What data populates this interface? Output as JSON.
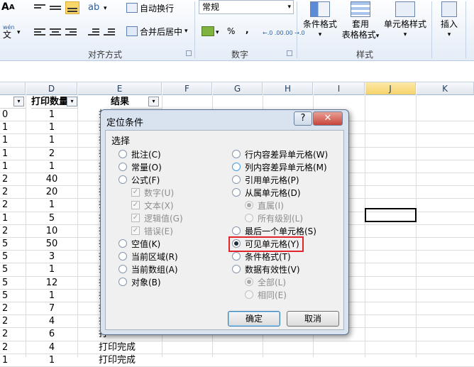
{
  "ribbon": {
    "font_size_label": "A",
    "wen_label": "wén",
    "wen_char": "文",
    "wrap_text": "自动换行",
    "merge_center": "合并后居中",
    "merge_arrow": "▾",
    "number_format": "常规",
    "number_format_arrow": "▾",
    "percent": "%",
    "comma": ",",
    "inc_decimal": "←.0 .00",
    "dec_decimal": ".00 →.0",
    "group_align": "对齐方式",
    "group_number": "数字",
    "group_styles": "样式",
    "cond_format": "条件格式",
    "format_table_1": "套用",
    "format_table_2": "表格格式",
    "cell_styles": "单元格样式",
    "insert": "插入",
    "dropdown_arrow": "▾"
  },
  "sheet": {
    "columns": [
      "D",
      "E",
      "F",
      "G",
      "H",
      "I",
      "J",
      "K"
    ],
    "selected_column": "J",
    "header_c": "",
    "header_d": "打印数量",
    "header_e": "结果",
    "col_c_values": [
      "0",
      "1",
      "1",
      "1",
      "1",
      "2",
      "2",
      "2",
      "1",
      "2",
      "5",
      "5",
      "5",
      "5",
      "5",
      "2",
      "2",
      "2",
      "2",
      "1"
    ],
    "col_d_values": [
      "1",
      "1",
      "1",
      "2",
      "1",
      "40",
      "20",
      "1",
      "5",
      "10",
      "50",
      "3",
      "1",
      "12",
      "1",
      "7",
      "4",
      "6",
      "4",
      "1"
    ],
    "e_partial_char": "打",
    "e_full_text": "打印完成",
    "cell_ref": ""
  },
  "dialog": {
    "title": "定位条件",
    "help": "?",
    "close": "✕",
    "select_label": "选择",
    "left_options": [
      {
        "label": "批注(C)"
      },
      {
        "label": "常量(O)"
      },
      {
        "label": "公式(F)"
      },
      {
        "label": "数字(U)"
      },
      {
        "label": "文本(X)"
      },
      {
        "label": "逻辑值(G)"
      },
      {
        "label": "错误(E)"
      },
      {
        "label": "空值(K)"
      },
      {
        "label": "当前区域(R)"
      },
      {
        "label": "当前数组(A)"
      },
      {
        "label": "对象(B)"
      }
    ],
    "right_options": [
      {
        "label": "行内容差异单元格(W)"
      },
      {
        "label": "列内容差异单元格(M)"
      },
      {
        "label": "引用单元格(P)"
      },
      {
        "label": "从属单元格(D)"
      },
      {
        "label": "直属(I)"
      },
      {
        "label": "所有级别(L)"
      },
      {
        "label": "最后一个单元格(S)"
      },
      {
        "label": "可见单元格(Y)"
      },
      {
        "label": "条件格式(T)"
      },
      {
        "label": "数据有效性(V)"
      },
      {
        "label": "全部(L)"
      },
      {
        "label": "相同(E)"
      }
    ],
    "selected_option": "可见单元格(Y)",
    "ok": "确定",
    "cancel": "取消",
    "check_mark": "✓"
  },
  "colors": {
    "ribbon_bg": "#e4ecf7",
    "selected_col": "#f6d36b",
    "dialog_frame": "#d9e3f0",
    "close_button": "#c8453b",
    "highlight_box": "#e0262a",
    "radio_focus": "#3c9be8"
  }
}
